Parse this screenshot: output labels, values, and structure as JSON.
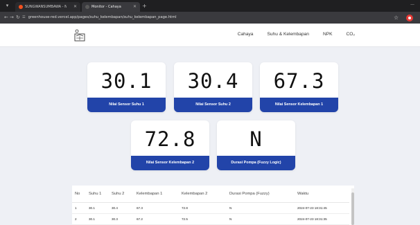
{
  "browser": {
    "tabs": [
      {
        "title": "SUNGWANSUMBAWA - Noc",
        "favicon_color": "#f4511e"
      },
      {
        "title": "Monitor - Cahaya",
        "favicon_color": "#5a5a5a"
      }
    ],
    "address": "greenhouse-red.vercel.app/pages/suhu_kelembapan/suhu_kelembapan_page.html"
  },
  "header": {
    "nav": [
      "Cahaya",
      "Suhu & Kelembapan",
      "NPK",
      "CO₂"
    ]
  },
  "cards": [
    {
      "value": "30.1",
      "label": "Nilai Sensor Suhu 1"
    },
    {
      "value": "30.4",
      "label": "Nilai Sensor Suhu 2"
    },
    {
      "value": "67.3",
      "label": "Nilai Sensor Kelembapan 1"
    },
    {
      "value": "72.8",
      "label": "Nilai Sensor Kelembapan 2"
    },
    {
      "value": "N",
      "label": "Durasi Pompa (Fuzzy Logic)"
    }
  ],
  "table": {
    "headers": [
      "No",
      "Suhu 1",
      "Suhu 2",
      "Kelembapan 1",
      "Kelembapan 2",
      "Durasi Pompa (Fuzzy)",
      "Waktu"
    ],
    "rows": [
      [
        "1",
        "30.1",
        "30.4",
        "67.3",
        "72.8",
        "N",
        "2024-07-23 18:31:45"
      ],
      [
        "2",
        "30.1",
        "30.3",
        "67.2",
        "72.5",
        "N",
        "2024-07-23 18:31:35"
      ]
    ]
  },
  "colors": {
    "accent": "#2244a9"
  }
}
